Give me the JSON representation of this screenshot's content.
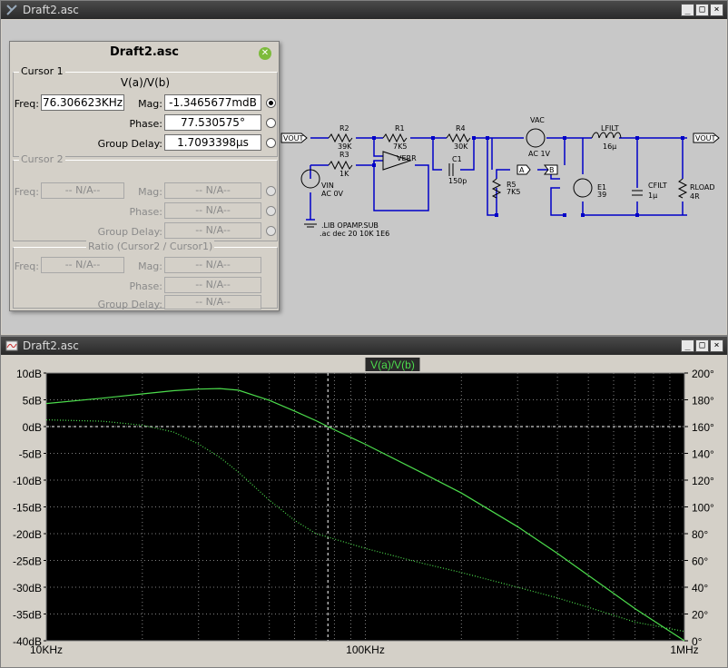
{
  "schematic_window": {
    "title": "Draft2.asc",
    "buttons": [
      "_",
      "□",
      "×"
    ]
  },
  "plot_window": {
    "title": "Draft2.asc",
    "buttons": [
      "_",
      "□",
      "×"
    ]
  },
  "cursor_dialog": {
    "title": "Draft2.asc",
    "cursor1": {
      "label": "Cursor 1",
      "expr": "V(a)/V(b)",
      "freq_label": "Freq:",
      "freq": "76.306623KHz",
      "mag_label": "Mag:",
      "mag": "-1.3465677mdB",
      "phase_label": "Phase:",
      "phase": "77.530575°",
      "gd_label": "Group Delay:",
      "gd": "1.7093398µs"
    },
    "cursor2": {
      "label": "Cursor 2",
      "freq_label": "Freq:",
      "freq": "-- N/A--",
      "mag_label": "Mag:",
      "mag": "-- N/A--",
      "phase_label": "Phase:",
      "phase": "-- N/A--",
      "gd_label": "Group Delay:",
      "gd": "-- N/A--"
    },
    "ratio": {
      "label": "Ratio (Cursor2 / Cursor1)",
      "freq_label": "Freq:",
      "freq": "-- N/A--",
      "mag_label": "Mag:",
      "mag": "-- N/A--",
      "phase_label": "Phase:",
      "phase": "-- N/A--",
      "gd_label": "Group Delay:",
      "gd": "-- N/A--"
    }
  },
  "schematic": {
    "labels": {
      "vout_in": "VOUT",
      "vout_out": "VOUT",
      "r2": "R2",
      "r2v": "39K",
      "r3": "R3",
      "r3v": "1K",
      "r1": "R1",
      "r1v": "7K5",
      "r4": "R4",
      "r4v": "30K",
      "c1": "C1",
      "c1v": "150p",
      "r5": "R5",
      "r5v": "7K5",
      "verr": "VERR",
      "vac": "VAC",
      "vacv": "AC 1V",
      "vin": "VIN",
      "vinv": "AC 0V",
      "e1": "E1",
      "e1v": "39",
      "lfilt": "LFILT",
      "lfiltv": "16µ",
      "cfilt": "CFILT",
      "cfiltv": "1µ",
      "rload": "RLOAD",
      "rloadv": "4R",
      "port_a": "A",
      "port_b": "B",
      "directive1": ".LIB OPAMP.SUB",
      "directive2": ".ac dec 20 10K 1E6"
    },
    "wire_color": "#0000c8"
  },
  "chart_data": {
    "type": "line",
    "title": "V(a)/V(b)",
    "x_scale": "log",
    "xlim": [
      10000,
      1000000
    ],
    "x_ticks": [
      "10KHz",
      "100KHz",
      "1MHz"
    ],
    "left_axis": {
      "ylim": [
        -40,
        10
      ],
      "ticks": [
        "10dB",
        "5dB",
        "0dB",
        "-5dB",
        "-10dB",
        "-15dB",
        "-20dB",
        "-25dB",
        "-30dB",
        "-35dB",
        "-40dB"
      ]
    },
    "right_axis": {
      "ylim": [
        0,
        200
      ],
      "ticks": [
        "200°",
        "180°",
        "160°",
        "140°",
        "120°",
        "100°",
        "80°",
        "60°",
        "40°",
        "20°",
        "0°"
      ]
    },
    "grid": true,
    "cursor_x": 76306.623,
    "series": [
      {
        "name": "V(a)/V(b)",
        "axis": "left",
        "style": "solid",
        "color": "#4cdc4c",
        "x": [
          10000,
          15000,
          20000,
          25000,
          30000,
          35000,
          40000,
          45000,
          50000,
          60000,
          70000,
          76306,
          80000,
          100000,
          150000,
          200000,
          300000,
          400000,
          500000,
          700000,
          1000000
        ],
        "y": [
          4.3,
          5.3,
          6.1,
          6.7,
          7.0,
          7.1,
          6.8,
          5.8,
          4.9,
          2.9,
          1.1,
          0.0,
          -0.6,
          -3.3,
          -8.6,
          -12.4,
          -18.7,
          -23.7,
          -27.8,
          -34.0,
          -40.0
        ]
      },
      {
        "name": "phase",
        "axis": "right",
        "style": "dotted",
        "color": "#4cdc4c",
        "x": [
          10000,
          15000,
          20000,
          25000,
          30000,
          35000,
          40000,
          45000,
          50000,
          60000,
          70000,
          76306,
          80000,
          100000,
          150000,
          200000,
          300000,
          400000,
          500000,
          700000,
          1000000
        ],
        "y": [
          165,
          164,
          161,
          156,
          147,
          137,
          126,
          115,
          105,
          90,
          80,
          77.5,
          76,
          69,
          58,
          51,
          40,
          32,
          25,
          14,
          7
        ]
      }
    ]
  }
}
